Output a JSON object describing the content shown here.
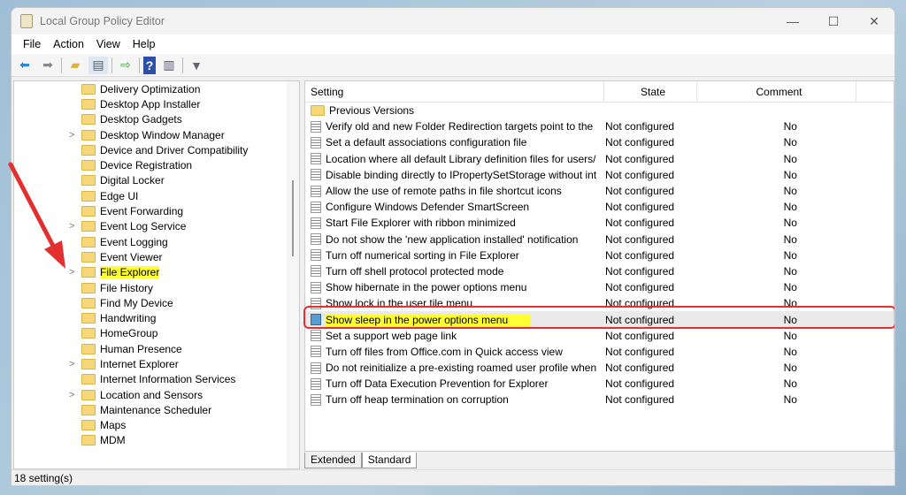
{
  "window": {
    "title": "Local Group Policy Editor",
    "controls": [
      "—",
      "☐",
      "✕"
    ]
  },
  "menu": [
    "File",
    "Action",
    "View",
    "Help"
  ],
  "toolbar": [
    "back-icon",
    "forward-icon",
    "up-folder-icon",
    "show-hide-tree-icon",
    "export-list-icon",
    "help-icon",
    "show-hide-action-pane-icon",
    "filter-icon"
  ],
  "tree": [
    {
      "label": "Delivery Optimization",
      "exp": false
    },
    {
      "label": "Desktop App Installer",
      "exp": false
    },
    {
      "label": "Desktop Gadgets",
      "exp": false
    },
    {
      "label": "Desktop Window Manager",
      "exp": true
    },
    {
      "label": "Device and Driver Compatibility",
      "exp": false
    },
    {
      "label": "Device Registration",
      "exp": false
    },
    {
      "label": "Digital Locker",
      "exp": false
    },
    {
      "label": "Edge UI",
      "exp": false
    },
    {
      "label": "Event Forwarding",
      "exp": false
    },
    {
      "label": "Event Log Service",
      "exp": true
    },
    {
      "label": "Event Logging",
      "exp": false
    },
    {
      "label": "Event Viewer",
      "exp": false
    },
    {
      "label": "File Explorer",
      "exp": true,
      "selected": true
    },
    {
      "label": "File History",
      "exp": false
    },
    {
      "label": "Find My Device",
      "exp": false
    },
    {
      "label": "Handwriting",
      "exp": false
    },
    {
      "label": "HomeGroup",
      "exp": false
    },
    {
      "label": "Human Presence",
      "exp": false
    },
    {
      "label": "Internet Explorer",
      "exp": true
    },
    {
      "label": "Internet Information Services",
      "exp": false
    },
    {
      "label": "Location and Sensors",
      "exp": true
    },
    {
      "label": "Maintenance Scheduler",
      "exp": false
    },
    {
      "label": "Maps",
      "exp": false
    },
    {
      "label": "MDM",
      "exp": false
    }
  ],
  "columns": {
    "setting": "Setting",
    "state": "State",
    "comment": "Comment"
  },
  "folder_row": "Previous Versions",
  "settings": [
    {
      "name": "Verify old and new Folder Redirection targets point to the sa...",
      "state": "Not configured",
      "comment": "No"
    },
    {
      "name": "Set a default associations configuration file",
      "state": "Not configured",
      "comment": "No"
    },
    {
      "name": "Location where all default Library definition files for users/m...",
      "state": "Not configured",
      "comment": "No"
    },
    {
      "name": "Disable binding directly to IPropertySetStorage without inter...",
      "state": "Not configured",
      "comment": "No"
    },
    {
      "name": "Allow the use of remote paths in file shortcut icons",
      "state": "Not configured",
      "comment": "No"
    },
    {
      "name": "Configure Windows Defender SmartScreen",
      "state": "Not configured",
      "comment": "No"
    },
    {
      "name": "Start File Explorer with ribbon minimized",
      "state": "Not configured",
      "comment": "No"
    },
    {
      "name": "Do not show the 'new application installed' notification",
      "state": "Not configured",
      "comment": "No"
    },
    {
      "name": "Turn off numerical sorting in File Explorer",
      "state": "Not configured",
      "comment": "No"
    },
    {
      "name": "Turn off shell protocol protected mode",
      "state": "Not configured",
      "comment": "No"
    },
    {
      "name": "Show hibernate in the power options menu",
      "state": "Not configured",
      "comment": "No"
    },
    {
      "name": "Show lock in the user tile menu",
      "state": "Not configured",
      "comment": "No"
    },
    {
      "name": "Show sleep in the power options menu",
      "state": "Not configured",
      "comment": "No",
      "selected": true
    },
    {
      "name": "Set a support web page link",
      "state": "Not configured",
      "comment": "No"
    },
    {
      "name": "Turn off files from Office.com in Quick access view",
      "state": "Not configured",
      "comment": "No"
    },
    {
      "name": "Do not reinitialize a pre-existing roamed user profile when it...",
      "state": "Not configured",
      "comment": "No"
    },
    {
      "name": "Turn off Data Execution Prevention for Explorer",
      "state": "Not configured",
      "comment": "No"
    },
    {
      "name": "Turn off heap termination on corruption",
      "state": "Not configured",
      "comment": "No"
    }
  ],
  "tabs": [
    "Extended",
    "Standard"
  ],
  "status": "18 setting(s)",
  "colors": {
    "highlight": "#ffff33",
    "annotation": "#e23030"
  }
}
